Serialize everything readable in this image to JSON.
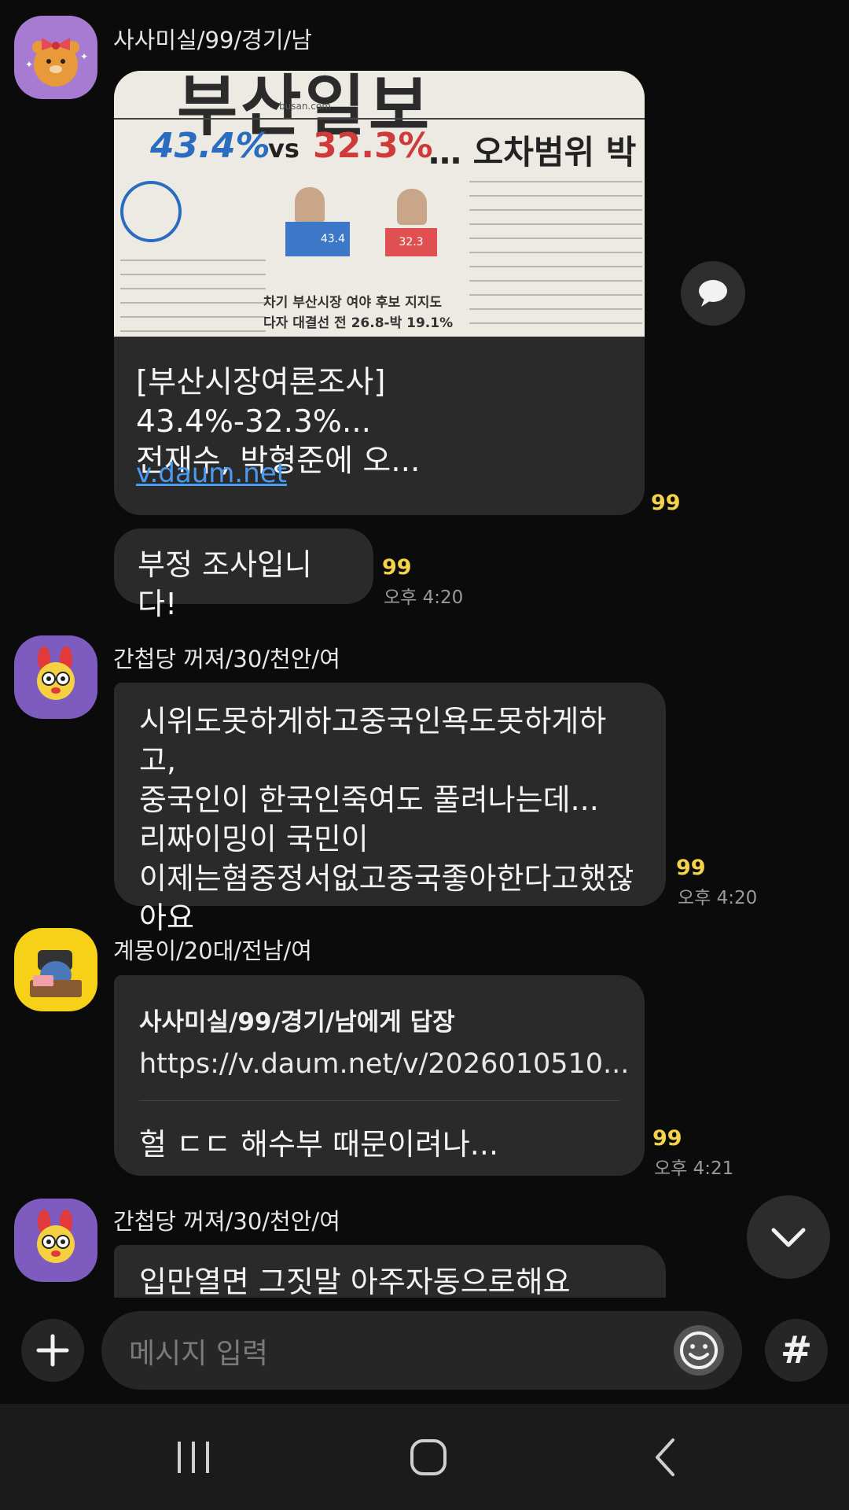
{
  "messages": [
    {
      "sender": "사사미실/99/경기/남",
      "link_preview": {
        "newspaper_name": "부산일보",
        "newspaper_site": "busan.com",
        "headline_pct_a": "43.4%",
        "headline_vs": "vs",
        "headline_pct_b": "32.3%",
        "headline_rest": "… 오차범위 박",
        "bar_a_value": "43.4",
        "bar_b_value": "32.3",
        "bottom_line_1": "차기 부산시장 여야 후보 지지도",
        "bottom_line_2": "다자 대결선 전 26.8-박 19.1%",
        "title": "[부산시장여론조사] 43.4%-32.3%...\n전재수, 박형준에 오...",
        "link": "v.daum.net",
        "unread": "99"
      },
      "text": "부정 조사입니다!",
      "unread": "99",
      "time": "오후 4:20"
    },
    {
      "sender": "간첩당 꺼져/30/천안/여",
      "text": "시위도못하게하고중국인욕도못하게하고,\n중국인이 한국인죽여도 풀려나는데...\n리짜이밍이 국민이\n이제는혐중정서없고중국좋아한다고했잖\n아요",
      "unread": "99",
      "time": "오후 4:20"
    },
    {
      "sender": "계몽이/20대/전남/여",
      "reply_to": "사사미실/99/경기/남에게 답장",
      "quote": "https://v.daum.net/v/2026010510...",
      "text": "헐 ㄷㄷ 해수부 때문이려나...",
      "unread": "99",
      "time": "오후 4:21"
    },
    {
      "sender": "간첩당 꺼져/30/천안/여",
      "text": "입만열면 그짓말 아주자동으로해요"
    }
  ],
  "input": {
    "placeholder": "메시지 입력",
    "hash_label": "#"
  },
  "icons": {
    "share": "chat-share-icon",
    "scroll_down": "chevron-down-icon",
    "plus": "plus-icon",
    "emoji": "emoji-icon",
    "nav_recent": "recent-apps-icon",
    "nav_home": "home-icon",
    "nav_back": "back-icon"
  },
  "colors": {
    "background": "#0b0b0b",
    "bubble": "#2a2a2a",
    "unread": "#f5d24a",
    "link": "#4a9bef"
  }
}
